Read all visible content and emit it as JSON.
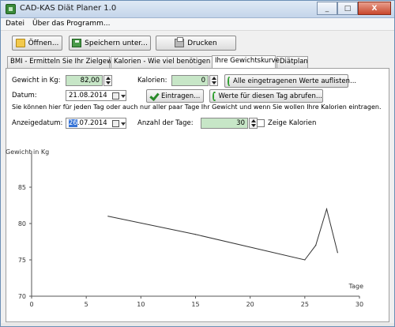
{
  "window": {
    "title": "CAD-KAS Diät Planer 1.0",
    "minimize": "_",
    "maximize": "□",
    "close": "X"
  },
  "menu": [
    "Datei",
    "Über das Programm..."
  ],
  "toolbar": {
    "open": "Öffnen...",
    "save": "Speichern unter...",
    "print": "Drucken"
  },
  "tabs": [
    "BMI - Ermitteln Sie Ihr Zielgewicht",
    "Kalorien - Wie viel benötigen Sie?",
    "Ihre Gewichtskurve",
    "Diätplan"
  ],
  "form": {
    "weight_label": "Gewicht in Kg:",
    "weight_value": "82,00",
    "calories_label": "Kalorien:",
    "calories_value": "0",
    "list_button": "Alle eingetragenen Werte auflisten...",
    "date_label": "Datum:",
    "date_value": "21.08.2014",
    "enter_button": "Eintragen...",
    "fetch_button": "Werte für diesen Tag abrufen...",
    "info_text": "Sie können hier für jeden Tag oder auch nur aller paar Tage Ihr Gewicht und wenn Sie wollen Ihre Kalorien eintragen.",
    "display_date_label": "Anzeigedatum:",
    "display_date_day": "26",
    "display_date_rest": ".07.2014",
    "days_label": "Anzahl der Tage:",
    "days_value": "30",
    "show_calories_label": "Zeige Kalorien"
  },
  "chart_data": {
    "type": "line",
    "ylabel": "Gewicht in Kg",
    "xlabel": "Tage",
    "xlim": [
      0,
      30
    ],
    "ylim": [
      70,
      90
    ],
    "xticks": [
      0,
      5,
      10,
      15,
      20,
      25,
      30
    ],
    "yticks": [
      70,
      75,
      80,
      85
    ],
    "series": [
      {
        "x": [
          7,
          15,
          25,
          26,
          27,
          28
        ],
        "y": [
          81,
          78.5,
          75,
          77,
          82,
          76
        ]
      }
    ]
  }
}
